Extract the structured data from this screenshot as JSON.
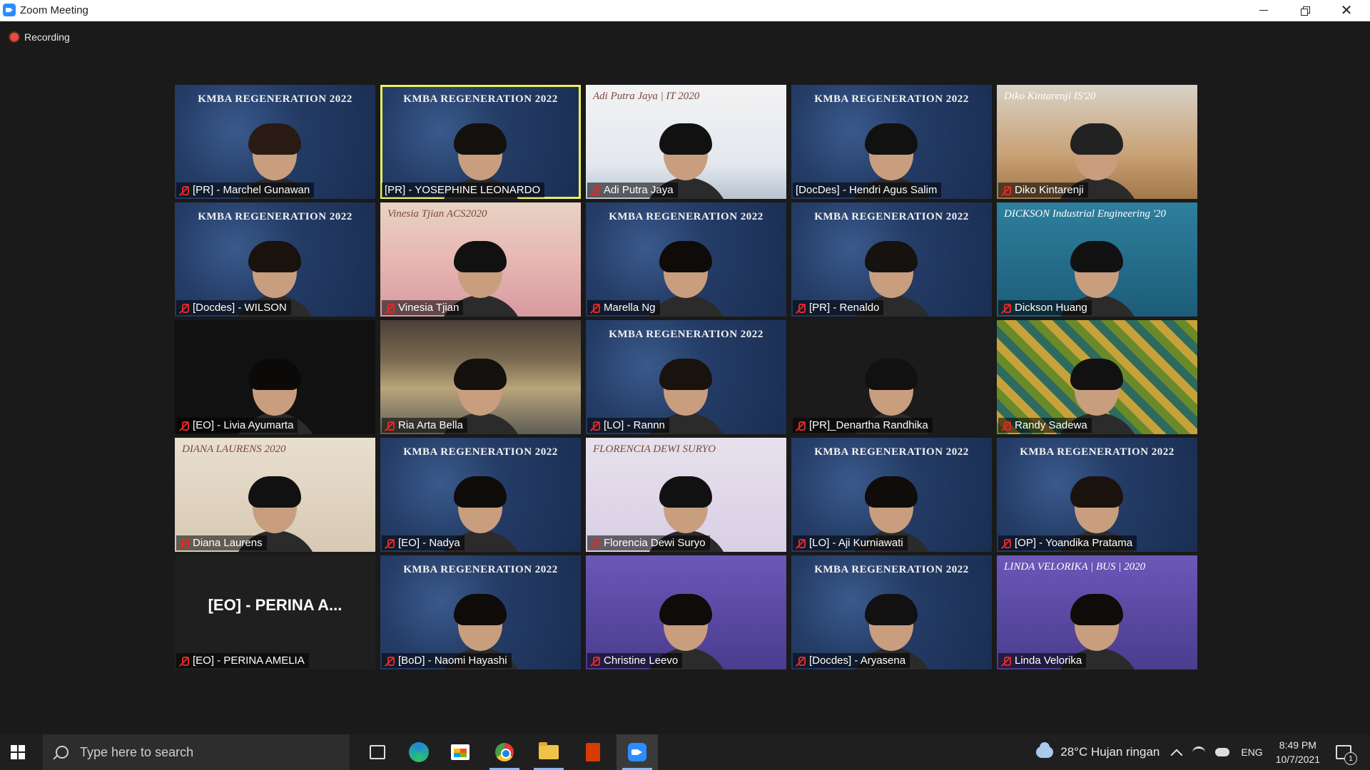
{
  "window": {
    "title": "Zoom Meeting",
    "close_glyph": "✕"
  },
  "meeting": {
    "recording_label": "Recording",
    "background_banner": "KMBA REGENERATION 2022",
    "participants": [
      {
        "name": "[PR] - Marchel Gunawan",
        "muted": true,
        "bg": "kmba",
        "hair": "#2a1a14"
      },
      {
        "name": "[PR] - YOSEPHINE LEONARDO",
        "muted": false,
        "bg": "kmba",
        "active": true,
        "hair": "#14100e"
      },
      {
        "name": "Adi Putra Jaya",
        "muted": true,
        "bg": "adi",
        "overlay": "Adi Putra Jaya | IT 2020",
        "hair": "#111"
      },
      {
        "name": "[DocDes] - Hendri Agus Salim",
        "muted": false,
        "bg": "kmba",
        "hair": "#111"
      },
      {
        "name": "Diko Kintarenji",
        "muted": true,
        "bg": "squid",
        "overlay": "Diko Kintarenji IS'20",
        "hair": "#222"
      },
      {
        "name": "[Docdes] - WILSON",
        "muted": true,
        "bg": "kmba",
        "hair": "#1a120d"
      },
      {
        "name": "Vinesia Tjian",
        "muted": true,
        "bg": "sunset",
        "overlay": "Vinesia Tjian ACS2020",
        "hair": "#111"
      },
      {
        "name": "Marella Ng",
        "muted": true,
        "bg": "kmba",
        "hair": "#0f0b09"
      },
      {
        "name": "[PR] - Renaldo",
        "muted": true,
        "bg": "kmba",
        "hair": "#161210"
      },
      {
        "name": "Dickson Huang",
        "muted": true,
        "bg": "class",
        "overlay": "DICKSON Industrial Engineering '20",
        "hair": "#111"
      },
      {
        "name": "[EO] - Livia Ayumarta",
        "muted": true,
        "bg": "livia",
        "hair": "#0c0a09"
      },
      {
        "name": "Ria Arta Bella",
        "muted": true,
        "bg": "road",
        "hair": "#14100e"
      },
      {
        "name": "[LO] - Rannn",
        "muted": true,
        "bg": "kmba",
        "hair": "#1a120d"
      },
      {
        "name": "[PR]_Denartha Randhika",
        "muted": true,
        "bg": "denartha",
        "hair": "#111"
      },
      {
        "name": "Randy Sadewa",
        "muted": true,
        "bg": "pattern",
        "hair": "#111"
      },
      {
        "name": "Diana Laurens",
        "muted": true,
        "bg": "flower",
        "overlay": "DIANA LAURENS 2020",
        "hair": "#111"
      },
      {
        "name": "[EO] - Nadya",
        "muted": true,
        "bg": "kmba",
        "hair": "#0f0b09"
      },
      {
        "name": "Florencia Dewi Suryo",
        "muted": true,
        "bg": "color",
        "overlay": "FLORENCIA DEWI SURYO",
        "hair": "#111"
      },
      {
        "name": "[LO] - Aji Kurniawati",
        "muted": true,
        "bg": "kmba",
        "hair": "#100c0a"
      },
      {
        "name": "[OP] - Yoandika Pratama",
        "muted": true,
        "bg": "kmba",
        "hair": "#1a120d"
      },
      {
        "name": "[EO] - PERINA AMELIA",
        "muted": true,
        "bg": "dark",
        "camera_off": true,
        "short_name": "[EO] - PERINA A..."
      },
      {
        "name": "[BoD] - Naomi Hayashi",
        "muted": true,
        "bg": "kmba",
        "hair": "#0f0b09"
      },
      {
        "name": "Christine Leevo",
        "muted": true,
        "bg": "space",
        "hair": "#0f0b09"
      },
      {
        "name": "[Docdes] - Aryasena",
        "muted": true,
        "bg": "kmba",
        "hair": "#111"
      },
      {
        "name": "Linda Velorika",
        "muted": true,
        "bg": "space",
        "overlay": "LINDA VELORIKA | BUS | 2020",
        "hair": "#0f0b09"
      }
    ]
  },
  "taskbar": {
    "search_placeholder": "Type here to search",
    "apps": [
      "task-view",
      "edge",
      "microsoft-store",
      "chrome",
      "file-explorer",
      "office",
      "zoom"
    ],
    "weather": "28°C  Hujan ringan",
    "language": "ENG",
    "time": "8:49 PM",
    "date": "10/7/2021",
    "notification_count": "1"
  },
  "colors": {
    "active_speaker": "#e9f05e",
    "muted": "#e02828",
    "recording": "#e74c3c",
    "zoom_blue": "#2d8cff"
  }
}
